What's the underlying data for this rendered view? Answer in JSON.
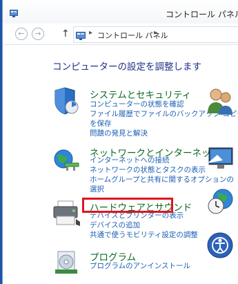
{
  "window": {
    "title": "コントロール パネル"
  },
  "navigation": {
    "back_glyph": "←",
    "forward_glyph": "→",
    "up_glyph": "↑",
    "breadcrumb": "コントロール パネル",
    "separator": "▸"
  },
  "heading": "コンピューターの設定を調整します",
  "categories": [
    {
      "title": "システムとセキュリティ",
      "links": [
        "コンピューターの状態を確認",
        "ファイル履歴でファイルのバックアップ コピー",
        "を保存",
        "問題の発見と解決"
      ]
    },
    {
      "title": "ネットワークとインターネット",
      "links": [
        "インターネットへの接続",
        "ネットワークの状態とタスクの表示",
        "ホームグループと共有に関するオプションの",
        "選択"
      ]
    },
    {
      "title": "ハードウェアとサウンド",
      "links": [
        "デバイスとプリンターの表示",
        "デバイスの追加",
        "共通で使うモビリティ設定の調整"
      ]
    },
    {
      "title": "プログラム",
      "links": [
        "プログラムのアンインストール"
      ]
    }
  ],
  "icons": {
    "title": "control-panel-icon",
    "security": "shield-icon",
    "network": "network-globe-icon",
    "hardware": "printer-icon",
    "programs": "programs-icon",
    "users": "user-accounts-icon",
    "appearance": "monitor-icon",
    "clock": "clock-globe-icon",
    "ease": "ease-of-access-icon"
  },
  "colors": {
    "desktop": "#1d55a8",
    "heading": "#1e3287",
    "category_title": "#0b6a1f",
    "link": "#1a5fb4",
    "highlight": "#e0141e"
  }
}
